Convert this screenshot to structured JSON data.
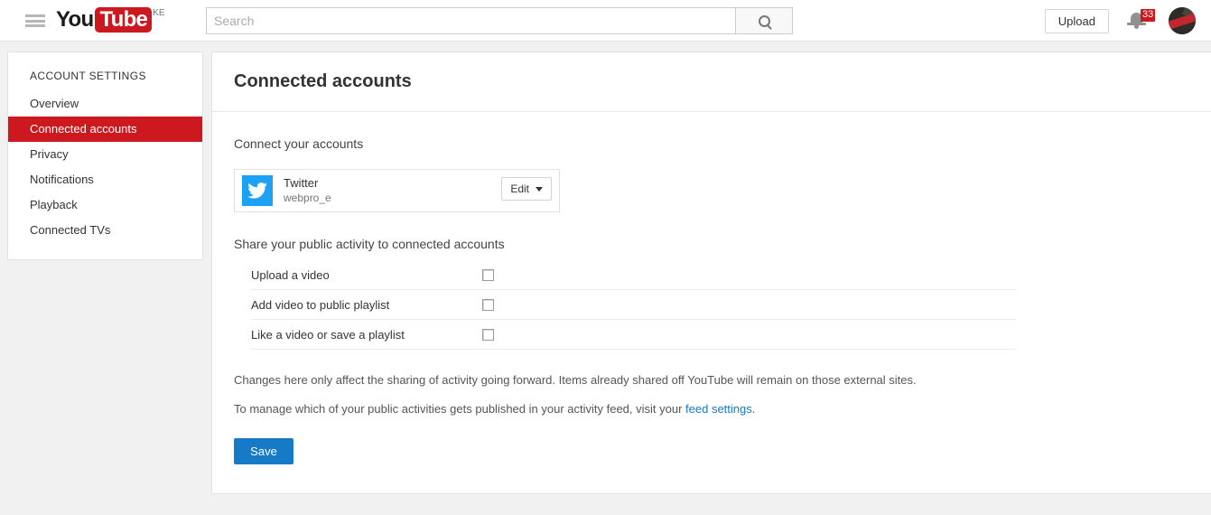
{
  "masthead": {
    "menu_icon": "hamburger-icon",
    "logo": {
      "you": "You",
      "tube": "Tube",
      "country_code": "KE"
    },
    "search": {
      "placeholder": "Search",
      "value": "",
      "button_icon": "search-icon"
    },
    "upload_label": "Upload",
    "notifications": {
      "icon": "bell-icon",
      "count": "33"
    },
    "avatar": {
      "icon": "avatar-image"
    }
  },
  "sidebar": {
    "title": "ACCOUNT SETTINGS",
    "items": [
      {
        "label": "Overview",
        "active": false
      },
      {
        "label": "Connected accounts",
        "active": true
      },
      {
        "label": "Privacy",
        "active": false
      },
      {
        "label": "Notifications",
        "active": false
      },
      {
        "label": "Playback",
        "active": false
      },
      {
        "label": "Connected TVs",
        "active": false
      }
    ]
  },
  "main": {
    "page_title": "Connected accounts",
    "connect_section_title": "Connect your accounts",
    "account": {
      "icon": "twitter-icon",
      "name": "Twitter",
      "handle": "webpro_e",
      "edit_label": "Edit",
      "edit_caret": "caret-down-icon"
    },
    "share_section_title": "Share your public activity to connected accounts",
    "share_rows": [
      {
        "label": "Upload a video",
        "checked": false
      },
      {
        "label": "Add video to public playlist",
        "checked": false
      },
      {
        "label": "Like a video or save a playlist",
        "checked": false
      }
    ],
    "note_one": "Changes here only affect the sharing of activity going forward. Items already shared off YouTube will remain on those external sites.",
    "note_two_prefix": "To manage which of your public activities gets published in your activity feed, visit your ",
    "note_two_link": "feed settings",
    "note_two_suffix": ".",
    "save_label": "Save"
  },
  "colors": {
    "brand_red": "#cc181e",
    "link_blue": "#167ac6",
    "twitter_blue": "#1da1f2",
    "page_bg": "#f1f1f1"
  }
}
